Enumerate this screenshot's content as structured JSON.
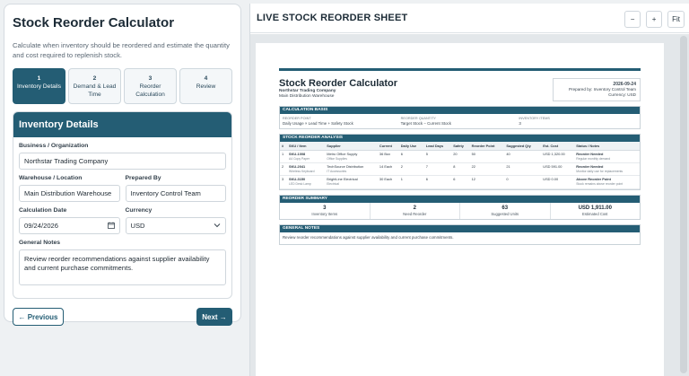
{
  "left": {
    "title": "Stock Reorder Calculator",
    "description": "Calculate when inventory should be reordered and estimate the quantity and cost required to replenish stock.",
    "steps": [
      {
        "num": "1",
        "label": "Inventory Details"
      },
      {
        "num": "2",
        "label": "Demand & Lead Time"
      },
      {
        "num": "3",
        "label": "Reorder Calculation"
      },
      {
        "num": "4",
        "label": "Review"
      }
    ],
    "card_title": "Inventory Details",
    "fields": {
      "business_label": "Business / Organization",
      "business_value": "Northstar Trading Company",
      "warehouse_label": "Warehouse / Location",
      "warehouse_value": "Main Distribution Warehouse",
      "prepared_label": "Prepared By",
      "prepared_value": "Inventory Control Team",
      "date_label": "Calculation Date",
      "date_value": "09/24/2026",
      "currency_label": "Currency",
      "currency_value": "USD",
      "notes_label": "General Notes",
      "notes_value": "Review reorder recommendations against supplier availability and current purchase commitments."
    },
    "prev_label": "← Previous",
    "next_label": "Next →"
  },
  "right": {
    "title": "LIVE STOCK REORDER SHEET",
    "zoom_out": "−",
    "zoom_in": "+",
    "fit": "Fit"
  },
  "sheet": {
    "title": "Stock Reorder Calculator",
    "company": "Northstar Trading Company",
    "location": "Main Distribution Warehouse",
    "date": "2026-09-24",
    "prepared": "Prepared by: Inventory Control Team",
    "currency": "Currency: USD",
    "basis_title": "CALCULATION BASIS",
    "basis": [
      {
        "k": "REORDER POINT",
        "v": "Daily Usage × Lead Time + Safety Stock"
      },
      {
        "k": "REORDER QUANTITY",
        "v": "Target Stock − Current Stock"
      },
      {
        "k": "INVENTORY ITEMS",
        "v": "3"
      }
    ],
    "analysis_title": "STOCK REORDER ANALYSIS",
    "columns": [
      "#",
      "SKU / Item",
      "Supplier",
      "Current",
      "Daily Use",
      "Lead Days",
      "Safety",
      "Reorder Point",
      "Suggested Qty",
      "Est. Cost",
      "Status / Notes"
    ],
    "rows": [
      {
        "n": "1",
        "sku": "SKU-1008",
        "item": "A4 Copy Paper",
        "supplier": "Metro Office Supply",
        "supplier_note": "Office Supplies",
        "current": "36 Box",
        "daily": "6",
        "lead": "5",
        "safety": "20",
        "rp": "50",
        "qty": "40",
        "cost": "USD 1,320.00",
        "status": "Reorder Needed",
        "status_note": "Regular monthly demand"
      },
      {
        "n": "2",
        "sku": "SKU-2041",
        "item": "Wireless Keyboard",
        "supplier": "TechSource Distribution",
        "supplier_note": "IT Accessories",
        "current": "14 Each",
        "daily": "2",
        "lead": "7",
        "safety": "8",
        "rp": "22",
        "qty": "21",
        "cost": "USD 591.00",
        "status": "Reorder Needed",
        "status_note": "Monitor daily use for replacements"
      },
      {
        "n": "3",
        "sku": "SKU-3150",
        "item": "LED Desk Lamp",
        "supplier": "BrightLine Electrical",
        "supplier_note": "Electrical",
        "current": "30 Each",
        "daily": "1",
        "lead": "6",
        "safety": "6",
        "rp": "12",
        "qty": "0",
        "cost": "USD 0.00",
        "status": "Above Reorder Point",
        "status_note": "Stock remains above reorder point"
      }
    ],
    "summary_title": "REORDER SUMMARY",
    "summary": [
      {
        "v": "3",
        "k": "Inventory Items"
      },
      {
        "v": "2",
        "k": "Need Reorder"
      },
      {
        "v": "63",
        "k": "Suggested Units"
      },
      {
        "v": "USD 1,911.00",
        "k": "Estimated Cost"
      }
    ],
    "notes_title": "GENERAL NOTES",
    "notes": "Review reorder recommendations against supplier availability and current purchase commitments."
  }
}
